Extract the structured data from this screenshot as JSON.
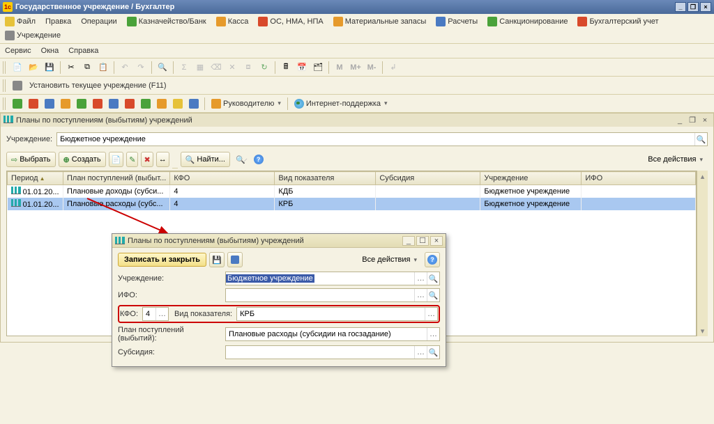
{
  "title": "Государственное учреждение / Бухгалтер",
  "menu": {
    "file": "Файл",
    "edit": "Правка",
    "operations": "Операции",
    "treasury": "Казначейство/Банк",
    "kassa": "Касса",
    "os": "ОС, НМА, НПА",
    "materials": "Материальные запасы",
    "calc": "Расчеты",
    "sanction": "Санкционирование",
    "account": "Бухгалтерский учет",
    "org": "Учреждение",
    "service": "Сервис",
    "windows": "Окна",
    "help": "Справка"
  },
  "toolbar3": {
    "setorg": "Установить текущее учреждение (F11)"
  },
  "toolbar4": {
    "manager": "Руководителю",
    "inet": "Интернет-поддержка"
  },
  "panel": {
    "title": "Планы по поступлениям (выбытиям) учреждений",
    "org_label": "Учреждение:",
    "org_value": "Бюджетное учреждение",
    "actions": {
      "select": "Выбрать",
      "create": "Создать",
      "find": "Найти...",
      "all": "Все действия"
    },
    "columns": [
      "Период",
      "План поступлений (выбыт...",
      "КФО",
      "Вид показателя",
      "Субсидия",
      "Учреждение",
      "ИФО"
    ],
    "rows": [
      {
        "period": "01.01.20...",
        "plan": "Плановые доходы (субси...",
        "kfo": "4",
        "vid": "КДБ",
        "sub": "",
        "org": "Бюджетное учреждение",
        "ifo": ""
      },
      {
        "period": "01.01.20...",
        "plan": "Плановые расходы (субс...",
        "kfo": "4",
        "vid": "КРБ",
        "sub": "",
        "org": "Бюджетное учреждение",
        "ifo": ""
      }
    ]
  },
  "dialog": {
    "title": "Планы по поступлениям (выбытиям) учреждений",
    "save": "Записать и закрыть",
    "all": "Все действия",
    "fields": {
      "org_label": "Учреждение:",
      "org_value": "Бюджетное учреждение",
      "ifo_label": "ИФО:",
      "ifo_value": "",
      "kfo_label": "КФО:",
      "kfo_value": "4",
      "vid_label": "Вид показателя:",
      "vid_value": "КРБ",
      "plan_label": "План поступлений (выбытий):",
      "plan_value": "Плановые расходы (субсидии на госзадание)",
      "sub_label": "Субсидия:",
      "sub_value": ""
    }
  }
}
